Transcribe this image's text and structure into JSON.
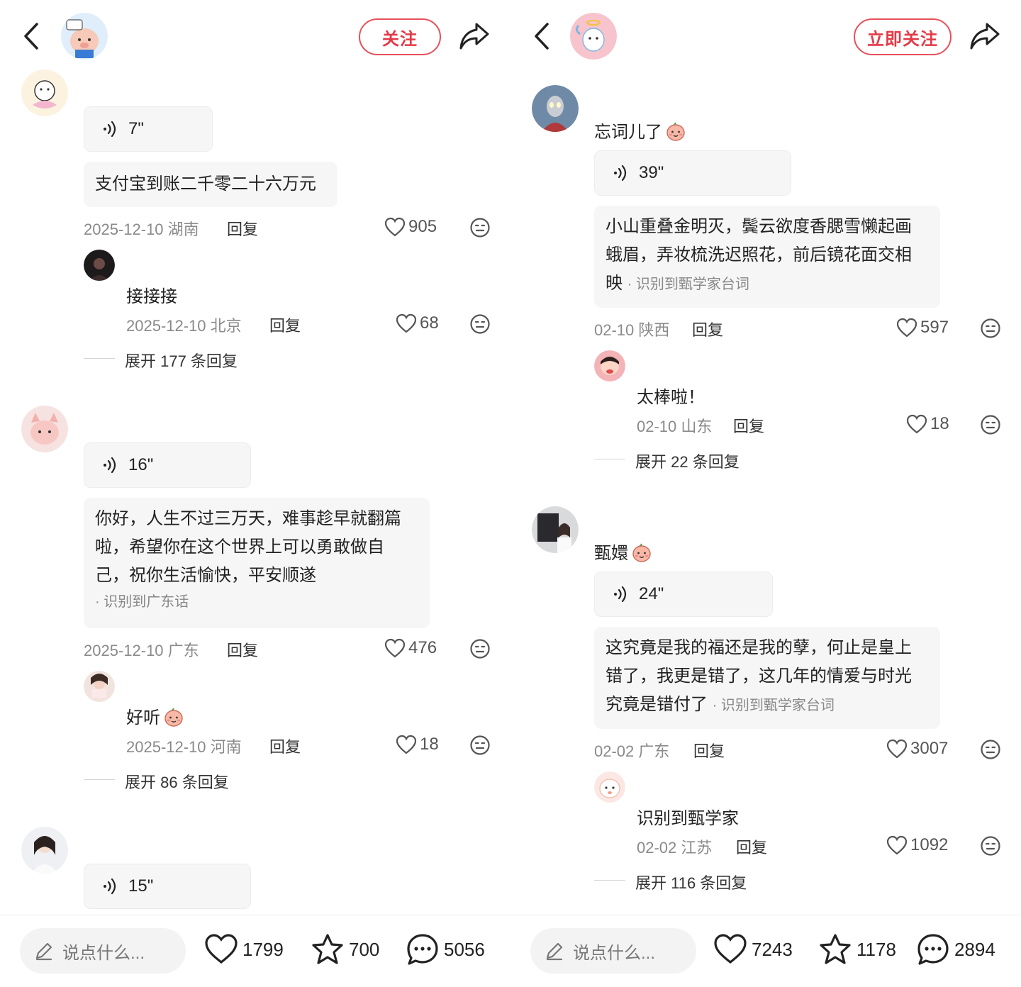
{
  "left": {
    "header": {
      "follow_label": "关注"
    },
    "comments": [
      {
        "voice": "7\"",
        "text": "支付宝到账二千零二十六万元",
        "date": "2025-12-10 湖南",
        "reply_label": "回复",
        "likes": "905",
        "sub": {
          "text": "接接接",
          "date": "2025-12-10 北京",
          "reply_label": "回复",
          "likes": "68"
        },
        "expand": "展开 177 条回复"
      },
      {
        "voice": "16\"",
        "text_lines": [
          "你好，人生不过三万天，难事趁早就翻篇",
          "啦，希望你在这个世界上可以勇敢做自",
          "己，祝你生活愉快，平安顺遂"
        ],
        "recognized": "· 识别到广东话",
        "date": "2025-12-10 广东",
        "reply_label": "回复",
        "likes": "476",
        "sub": {
          "text": "好听",
          "date": "2025-12-10 河南",
          "reply_label": "回复",
          "likes": "18"
        },
        "expand": "展开 86 条回复"
      },
      {
        "voice": "15\""
      }
    ],
    "bottom": {
      "placeholder": "说点什么...",
      "likes": "1799",
      "stars": "700",
      "comments": "5056"
    }
  },
  "right": {
    "header": {
      "follow_label": "立即关注"
    },
    "comments": [
      {
        "title": "忘词儿了",
        "voice": "39\"",
        "text_lines": [
          "小山重叠金明灭，鬓云欲度香腮雪懒起画",
          "蛾眉，弄妆梳洗迟照花，前后镜花面交相"
        ],
        "last_line": "映",
        "recognized": "· 识别到甄学家台词",
        "date": "02-10 陕西",
        "reply_label": "回复",
        "likes": "597",
        "sub": {
          "text": "太棒啦！",
          "date": "02-10 山东",
          "reply_label": "回复",
          "likes": "18"
        },
        "expand": "展开 22 条回复"
      },
      {
        "title": "甄嬛",
        "voice": "24\"",
        "text_lines": [
          "这究竟是我的福还是我的孽，何止是皇上",
          "错了，我更是错了，这几年的情爱与时光"
        ],
        "last_line": "究竟是错付了",
        "recognized": "· 识别到甄学家台词",
        "date": "02-02 广东",
        "reply_label": "回复",
        "likes": "3007",
        "sub": {
          "text": "识别到甄学家",
          "date": "02-02 江苏",
          "reply_label": "回复",
          "likes": "1092"
        },
        "expand": "展开 116 条回复"
      }
    ],
    "bottom": {
      "placeholder": "说点什么...",
      "likes": "7243",
      "stars": "1178",
      "comments": "2894"
    }
  },
  "icons": [
    "back-icon",
    "share-icon",
    "voice-wave-icon",
    "heart-icon",
    "emoji-face-icon",
    "pencil-icon",
    "star-icon",
    "comment-bubble-icon"
  ],
  "colors": {
    "accent": "#e33a47",
    "bubble_bg": "#f6f6f6",
    "meta": "#8a8a8a"
  }
}
